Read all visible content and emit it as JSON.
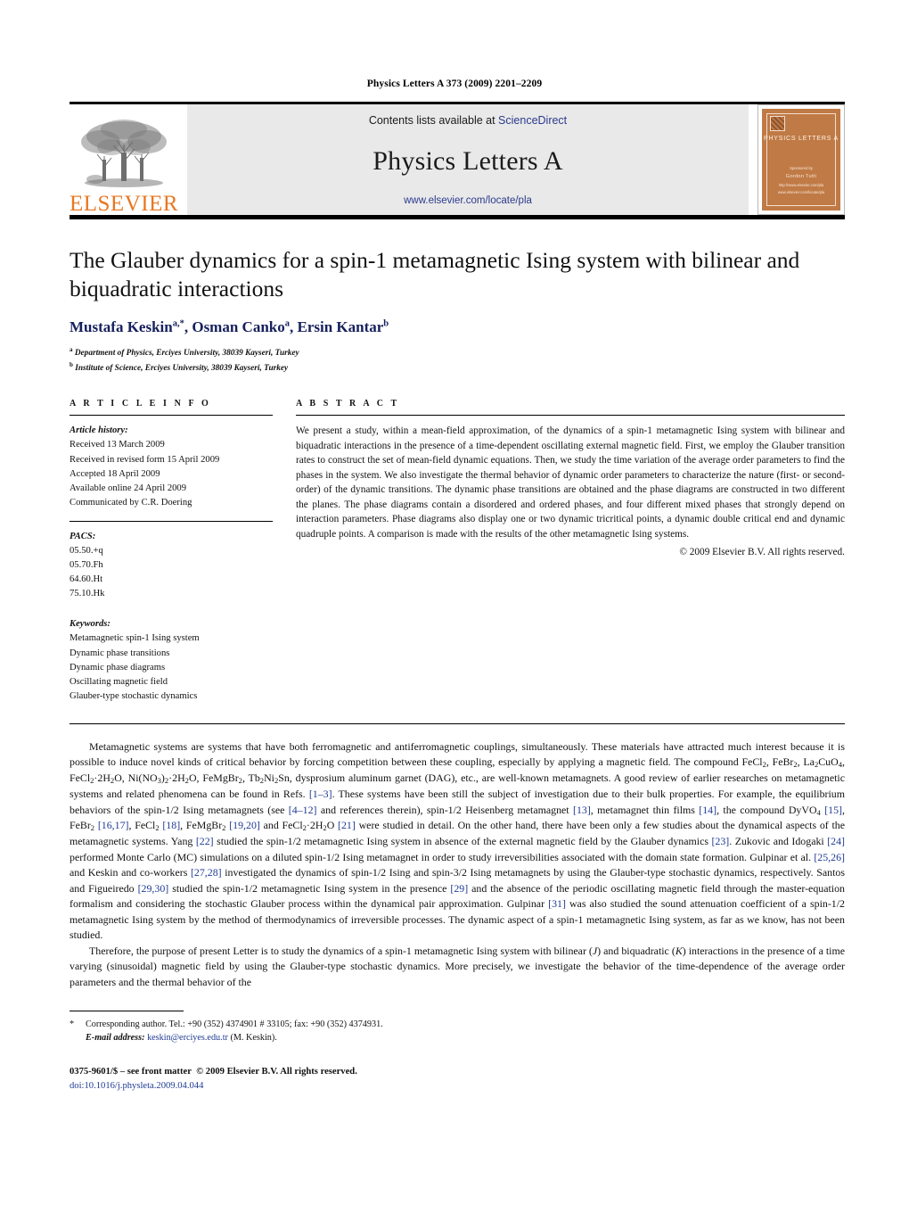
{
  "running_head": "Physics Letters A 373 (2009) 2201–2209",
  "masthead": {
    "publisher": "ELSEVIER",
    "contents_prefix": "Contents lists available at ",
    "contents_link": "ScienceDirect",
    "journal_title": "Physics Letters A",
    "journal_url": "www.elsevier.com/locate/pla",
    "cover": {
      "title": "PHYSICS LETTERS A",
      "line1": "Sponsored by",
      "line2": "Gordon Tutti",
      "line3": "http://www.elsevier.com/pla",
      "line4": "www.elsevier.com/locate/pla",
      "color": "#c07a45"
    }
  },
  "article": {
    "title": "The Glauber dynamics for a spin-1 metamagnetic Ising system with bilinear and biquadratic interactions",
    "authors": [
      {
        "name": "Mustafa Keskin",
        "marks": "a,*"
      },
      {
        "name": "Osman Canko",
        "marks": "a"
      },
      {
        "name": "Ersin Kantar",
        "marks": "b"
      }
    ],
    "affiliations": [
      {
        "mark": "a",
        "text": "Department of Physics, Erciyes University, 38039 Kayseri, Turkey"
      },
      {
        "mark": "b",
        "text": "Institute of Science, Erciyes University, 38039 Kayseri, Turkey"
      }
    ]
  },
  "info": {
    "heading": "A R T I C L E   I N F O",
    "history_label": "Article history:",
    "history": [
      "Received 13 March 2009",
      "Received in revised form 15 April 2009",
      "Accepted 18 April 2009",
      "Available online 24 April 2009",
      "Communicated by C.R. Doering"
    ],
    "pacs_label": "PACS:",
    "pacs": [
      "05.50.+q",
      "05.70.Fh",
      "64.60.Ht",
      "75.10.Hk"
    ],
    "keywords_label": "Keywords:",
    "keywords": [
      "Metamagnetic spin-1 Ising system",
      "Dynamic phase transitions",
      "Dynamic phase diagrams",
      "Oscillating magnetic field",
      "Glauber-type stochastic dynamics"
    ]
  },
  "abstract": {
    "heading": "A B S T R A C T",
    "text": "We present a study, within a mean-field approximation, of the dynamics of a spin-1 metamagnetic Ising system with bilinear and biquadratic interactions in the presence of a time-dependent oscillating external magnetic field. First, we employ the Glauber transition rates to construct the set of mean-field dynamic equations. Then, we study the time variation of the average order parameters to find the phases in the system. We also investigate the thermal behavior of dynamic order parameters to characterize the nature (first- or second-order) of the dynamic transitions. The dynamic phase transitions are obtained and the phase diagrams are constructed in two different the planes. The phase diagrams contain a disordered and ordered phases, and four different mixed phases that strongly depend on interaction parameters. Phase diagrams also display one or two dynamic tricritical points, a dynamic double critical end and dynamic quadruple points. A comparison is made with the results of the other metamagnetic Ising systems.",
    "copyright": "© 2009 Elsevier B.V. All rights reserved."
  },
  "body": {
    "p1_a": "Metamagnetic systems are systems that have both ferromagnetic and antiferromagnetic couplings, simultaneously. These materials have attracted much interest because it is possible to induce novel kinds of critical behavior by forcing competition between these coupling, especially by applying a magnetic field. The compound FeCl",
    "p1_b": ", FeBr",
    "p1_c": ", La",
    "p1_d": "CuO",
    "p1_e": ", FeCl",
    "p1_f": "·2H",
    "p1_g": "O, Ni(NO",
    "p1_h": ")",
    "p1_i": "·2H",
    "p1_j": "O, FeMgBr",
    "p1_k": ", Tb",
    "p1_l": "Ni",
    "p1_m": "Sn, dysprosium aluminum garnet (DAG), etc., are well-known metamagnets. A good review of earlier researches on metamagnetic systems and related phenomena can be found in Refs. ",
    "ref_1_3": "[1–3]",
    "p1_n": ". These systems have been still the subject of investigation due to their bulk properties. For example, the equilibrium behaviors of the spin-1/2 Ising metamagnets (see ",
    "ref_4_12": "[4–12]",
    "p1_o": " and references therein), spin-1/2 Heisenberg metamagnet ",
    "ref_13": "[13]",
    "p1_p": ", metamagnet thin films ",
    "ref_14": "[14]",
    "p1_q": ", the compound DyVO",
    "ref_15": "[15]",
    "ref_16_17": "[16,17]",
    "ref_18": "[18]",
    "ref_19_20": "[19,20]",
    "ref_21": "[21]",
    "p1_r": " were studied in detail. On the other hand, there have been only a few studies about the dynamical aspects of the metamagnetic systems. Yang ",
    "ref_22": "[22]",
    "p1_s": " studied the spin-1/2 metamagnetic Ising system in absence of the external magnetic field by the Glauber dynamics ",
    "ref_23": "[23]",
    "p1_t": ". Zukovic and Idogaki ",
    "ref_24": "[24]",
    "p1_u": " performed Monte Carlo (MC) simulations on a diluted spin-1/2 Ising metamagnet in order to study irreversibilities associated with the domain state formation. Gulpinar et al. ",
    "ref_25_26": "[25,26]",
    "p1_v": " and Keskin and co-workers ",
    "ref_27_28": "[27,28]",
    "p1_w": " investigated the dynamics of spin-1/2 Ising and spin-3/2 Ising metamagnets by using the Glauber-type stochastic dynamics, respectively. Santos and Figueiredo ",
    "ref_29_30": "[29,30]",
    "p1_x": " studied the spin-1/2 metamagnetic Ising system in the presence ",
    "ref_29": "[29]",
    "p1_y": " and the absence of the periodic oscillating magnetic field through the master-equation formalism and considering the stochastic Glauber process within the dynamical pair approximation. Gulpinar ",
    "ref_31": "[31]",
    "p1_z": " was also studied the sound attenuation coefficient of a spin-1/2 metamagnetic Ising system by the method of thermodynamics of irreversible processes. The dynamic aspect of a spin-1 metamagnetic Ising system, as far as we know, has not been studied.",
    "p2_a": "Therefore, the purpose of present Letter is to study the dynamics of a spin-1 metamagnetic Ising system with bilinear (",
    "p2_J": "J",
    "p2_b": ") and biquadratic (",
    "p2_K": "K",
    "p2_c": ") interactions in the presence of a time varying (sinusoidal) magnetic field by using the Glauber-type stochastic dynamics. More precisely, we investigate the behavior of the time-dependence of the average order parameters and the thermal behavior of the"
  },
  "footnotes": {
    "star": "*",
    "corresponding": "Corresponding author. Tel.: +90 (352) 4374901 # 33105; fax: +90 (352) 4374931.",
    "email_label": "E-mail address:",
    "email": "keskin@erciyes.edu.tr",
    "email_owner": "(M. Keskin)."
  },
  "footer": {
    "issn": "0375-9601/$ – see front matter",
    "copyright": "© 2009 Elsevier B.V. All rights reserved.",
    "doi": "doi:10.1016/j.physleta.2009.04.044"
  }
}
